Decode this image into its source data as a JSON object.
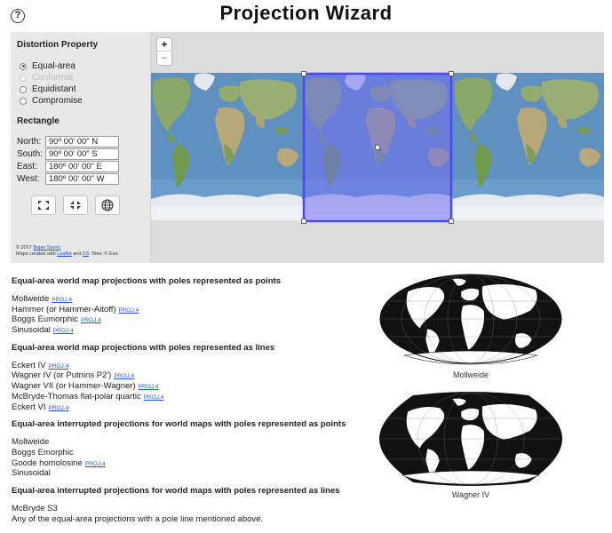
{
  "header": {
    "title": "Projection  Wizard",
    "help_glyph": "?"
  },
  "panel": {
    "distortion_title": "Distortion Property",
    "options": [
      {
        "label": "Equal-area",
        "checked": true,
        "disabled": false
      },
      {
        "label": "Conformal",
        "checked": false,
        "disabled": true
      },
      {
        "label": "Equidistant",
        "checked": false,
        "disabled": false
      },
      {
        "label": "Compromise",
        "checked": false,
        "disabled": false
      }
    ],
    "rectangle_title": "Rectangle",
    "coords": {
      "north_label": "North:",
      "north_value": "90º 00' 00\" N",
      "south_label": "South:",
      "south_value": "90º 00' 00\" S",
      "east_label": "East:",
      "east_value": "180º 00' 00\" E",
      "west_label": "West:",
      "west_value": "180º 00' 00\" W"
    },
    "attribution": {
      "line1_prefix": "© 2017 ",
      "author": "Bojan Savric",
      "line2_prefix": "Maps created with ",
      "leaflet": "Leaflet",
      "and": " and ",
      "d3": "D3",
      "tiles": ". Tiles: © Esri."
    }
  },
  "map": {
    "zoom_in": "+",
    "zoom_out": "−"
  },
  "results": {
    "group1": {
      "title": "Equal-area world map projections with poles represented as points",
      "items": [
        {
          "name": "Mollweide",
          "link": "PROJ.4"
        },
        {
          "name": "Hammer (or Hammer-Aitoff)",
          "link": "PROJ.4"
        },
        {
          "name": "Boggs Eumorphic",
          "link": "PROJ.4"
        },
        {
          "name": "Sinusoidal",
          "link": "PROJ.4"
        }
      ]
    },
    "group2": {
      "title": "Equal-area world map projections with poles represented as lines",
      "items": [
        {
          "name": "Eckert IV",
          "link": "PROJ.4"
        },
        {
          "name": "Wagner IV (or Putnins P2')",
          "link": "PROJ.4"
        },
        {
          "name": "Wagner VII (or Hammer-Wagner)",
          "link": "PROJ.4"
        },
        {
          "name": "McBryde-Thomas flat-polar quartic",
          "link": "PROJ.4"
        },
        {
          "name": "Eckert VI",
          "link": "PROJ.4"
        }
      ]
    },
    "group3": {
      "title": "Equal-area interrupted projections for world maps with poles represented as points",
      "items": [
        {
          "name": "Mollweide",
          "link": ""
        },
        {
          "name": "Boggs Emorphic",
          "link": ""
        },
        {
          "name": "Goode homolosine",
          "link": "PROJ.4"
        },
        {
          "name": "Sinusoidal",
          "link": ""
        }
      ]
    },
    "group4": {
      "title": "Equal-area interrupted projections for world maps with poles represented as lines",
      "items": [
        {
          "name": "McBryde S3",
          "link": ""
        },
        {
          "name": "Any of the equal-area projections with a pole line mentioned above.",
          "link": ""
        }
      ]
    }
  },
  "previews": {
    "caption1": "Mollweide",
    "caption2": "Wagner IV"
  },
  "colors": {
    "selection": "#5b5bf0",
    "ocean": "#5e8fbd",
    "land": "#8aa86a",
    "ice": "#e9ecf2",
    "link": "#2457e8"
  }
}
